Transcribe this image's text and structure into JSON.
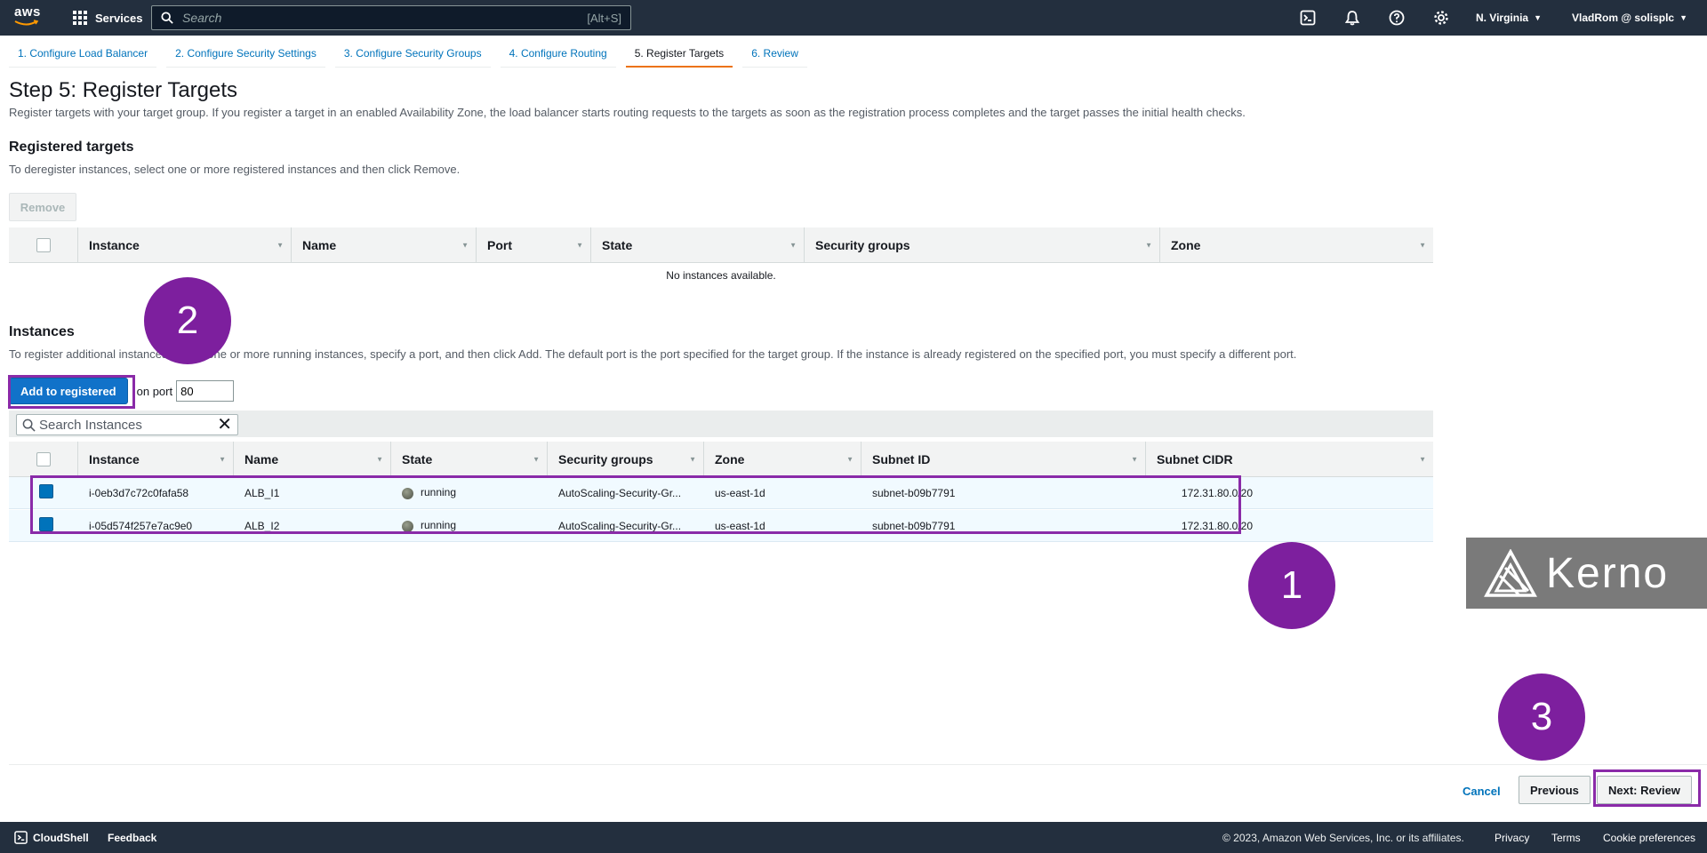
{
  "topnav": {
    "logo_text": "aws",
    "services_label": "Services",
    "search_placeholder": "Search",
    "search_shortcut": "[Alt+S]",
    "region": "N. Virginia",
    "account": "VladRom @ solisplc"
  },
  "steps": [
    {
      "label": "1. Configure Load Balancer"
    },
    {
      "label": "2. Configure Security Settings"
    },
    {
      "label": "3. Configure Security Groups"
    },
    {
      "label": "4. Configure Routing"
    },
    {
      "label": "5. Register Targets",
      "active": true
    },
    {
      "label": "6. Review"
    }
  ],
  "page": {
    "title": "Step 5: Register Targets",
    "description": "Register targets with your target group. If you register a target in an enabled Availability Zone, the load balancer starts routing requests to the targets as soon as the registration process completes and the target passes the initial health checks."
  },
  "registered": {
    "title": "Registered targets",
    "description": "To deregister instances, select one or more registered instances and then click Remove.",
    "remove_label": "Remove",
    "columns": [
      "Instance",
      "Name",
      "Port",
      "State",
      "Security groups",
      "Zone"
    ],
    "empty_text": "No instances available."
  },
  "instances": {
    "title": "Instances",
    "description": "To register additional instances, select one or more running instances, specify a port, and then click Add. The default port is the port specified for the target group. If the instance is already registered on the specified port, you must specify a different port.",
    "add_label": "Add to registered",
    "on_port_label": "on port",
    "port_value": "80",
    "search_placeholder": "Search Instances",
    "columns": [
      "Instance",
      "Name",
      "State",
      "Security groups",
      "Zone",
      "Subnet ID",
      "Subnet CIDR"
    ],
    "rows": [
      {
        "instance": "i-0eb3d7c72c0fafa58",
        "name": "ALB_I1",
        "state": "running",
        "security_groups": "AutoScaling-Security-Gr...",
        "zone": "us-east-1d",
        "subnet_id": "subnet-b09b7791",
        "subnet_cidr": "172.31.80.0/20",
        "checked": true
      },
      {
        "instance": "i-05d574f257e7ac9e0",
        "name": "ALB_I2",
        "state": "running",
        "security_groups": "AutoScaling-Security-Gr...",
        "zone": "us-east-1d",
        "subnet_id": "subnet-b09b7791",
        "subnet_cidr": "172.31.80.0/20",
        "checked": true
      }
    ]
  },
  "annotations": {
    "one": "1",
    "two": "2",
    "three": "3"
  },
  "watermark": {
    "text": "Kerno"
  },
  "actions": {
    "cancel": "Cancel",
    "previous": "Previous",
    "next": "Next: Review"
  },
  "footer": {
    "cloudshell": "CloudShell",
    "feedback": "Feedback",
    "copyright": "© 2023, Amazon Web Services, Inc. or its affiliates.",
    "privacy": "Privacy",
    "terms": "Terms",
    "cookies": "Cookie preferences"
  },
  "colors": {
    "nav_bg": "#232f3e",
    "link": "#0073bb",
    "primary": "#1172c9",
    "accent_tab": "#ec7211",
    "annotation": "#7d1f9e",
    "selected_row": "#f1faff"
  }
}
